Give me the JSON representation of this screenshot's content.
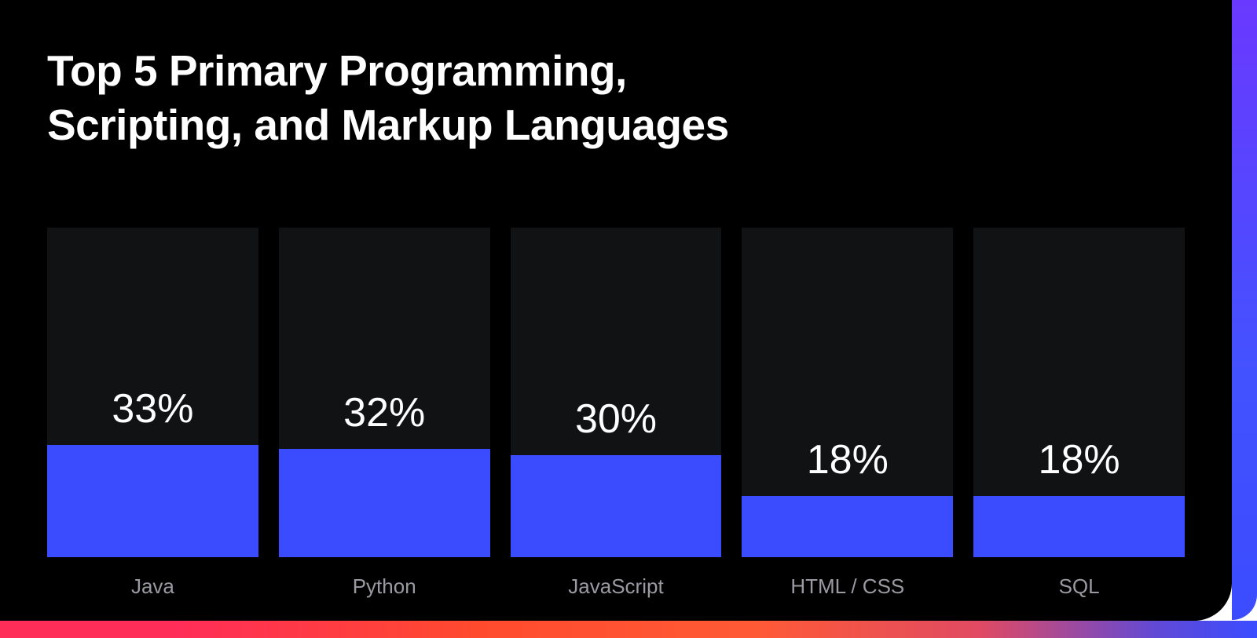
{
  "title_line1": "Top 5 Primary Programming,",
  "title_line2": "Scripting, and Markup Languages",
  "colors": {
    "background": "#000000",
    "bar_backdrop": "#111214",
    "bar_fill": "#3b4cff",
    "text": "#ffffff",
    "category_text": "#9a9aa2"
  },
  "chart_data": {
    "type": "bar",
    "title": "Top 5 Primary Programming, Scripting, and Markup Languages",
    "xlabel": "",
    "ylabel": "",
    "ylim": [
      0,
      100
    ],
    "categories": [
      "Java",
      "Python",
      "JavaScript",
      "HTML / CSS",
      "SQL"
    ],
    "values": [
      33,
      32,
      30,
      18,
      18
    ],
    "value_labels": [
      "33%",
      "32%",
      "30%",
      "18%",
      "18%"
    ]
  }
}
